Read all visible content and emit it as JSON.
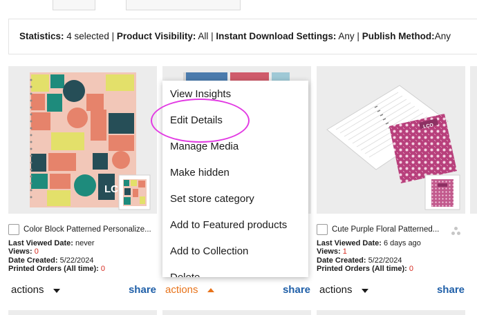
{
  "stats": {
    "statistics_label": "Statistics:",
    "statistics_value": " 4 selected | ",
    "visibility_label": "Product Visibility:",
    "visibility_value": " All | ",
    "download_label": "Instant Download Settings:",
    "download_value": " Any | ",
    "publish_label": "Publish Method:",
    "publish_value": "Any"
  },
  "labels": {
    "last_viewed": "Last Viewed Date:",
    "views": "Views:",
    "date_created": "Date Created:",
    "printed_orders": "Printed Orders (All time):"
  },
  "products": [
    {
      "title": "Color Block Patterned Personalize...",
      "last_viewed": " never",
      "views": "0",
      "date_created": " 5/22/2024",
      "printed_orders": "0",
      "actions": "actions",
      "share": "share"
    },
    {
      "actions": "actions",
      "share": "share"
    },
    {
      "title": "Cute Purple Floral Patterned...",
      "last_viewed": " 6 days ago",
      "views": "1",
      "date_created": " 5/22/2024",
      "printed_orders": "0",
      "actions": "actions",
      "share": "share"
    }
  ],
  "menu": {
    "items": [
      "View Insights",
      "Edit Details",
      "Manage Media",
      "Make hidden",
      "Set store category",
      "Add to Featured products",
      "Add to Collection",
      "Delete"
    ]
  },
  "thumb_text": {
    "monogram": "LCO"
  },
  "colors": {
    "accent_orange": "#e8731a",
    "share_blue": "#1f5fa8",
    "value_red": "#d62a1f",
    "highlight_magenta": "#e23ae3"
  }
}
